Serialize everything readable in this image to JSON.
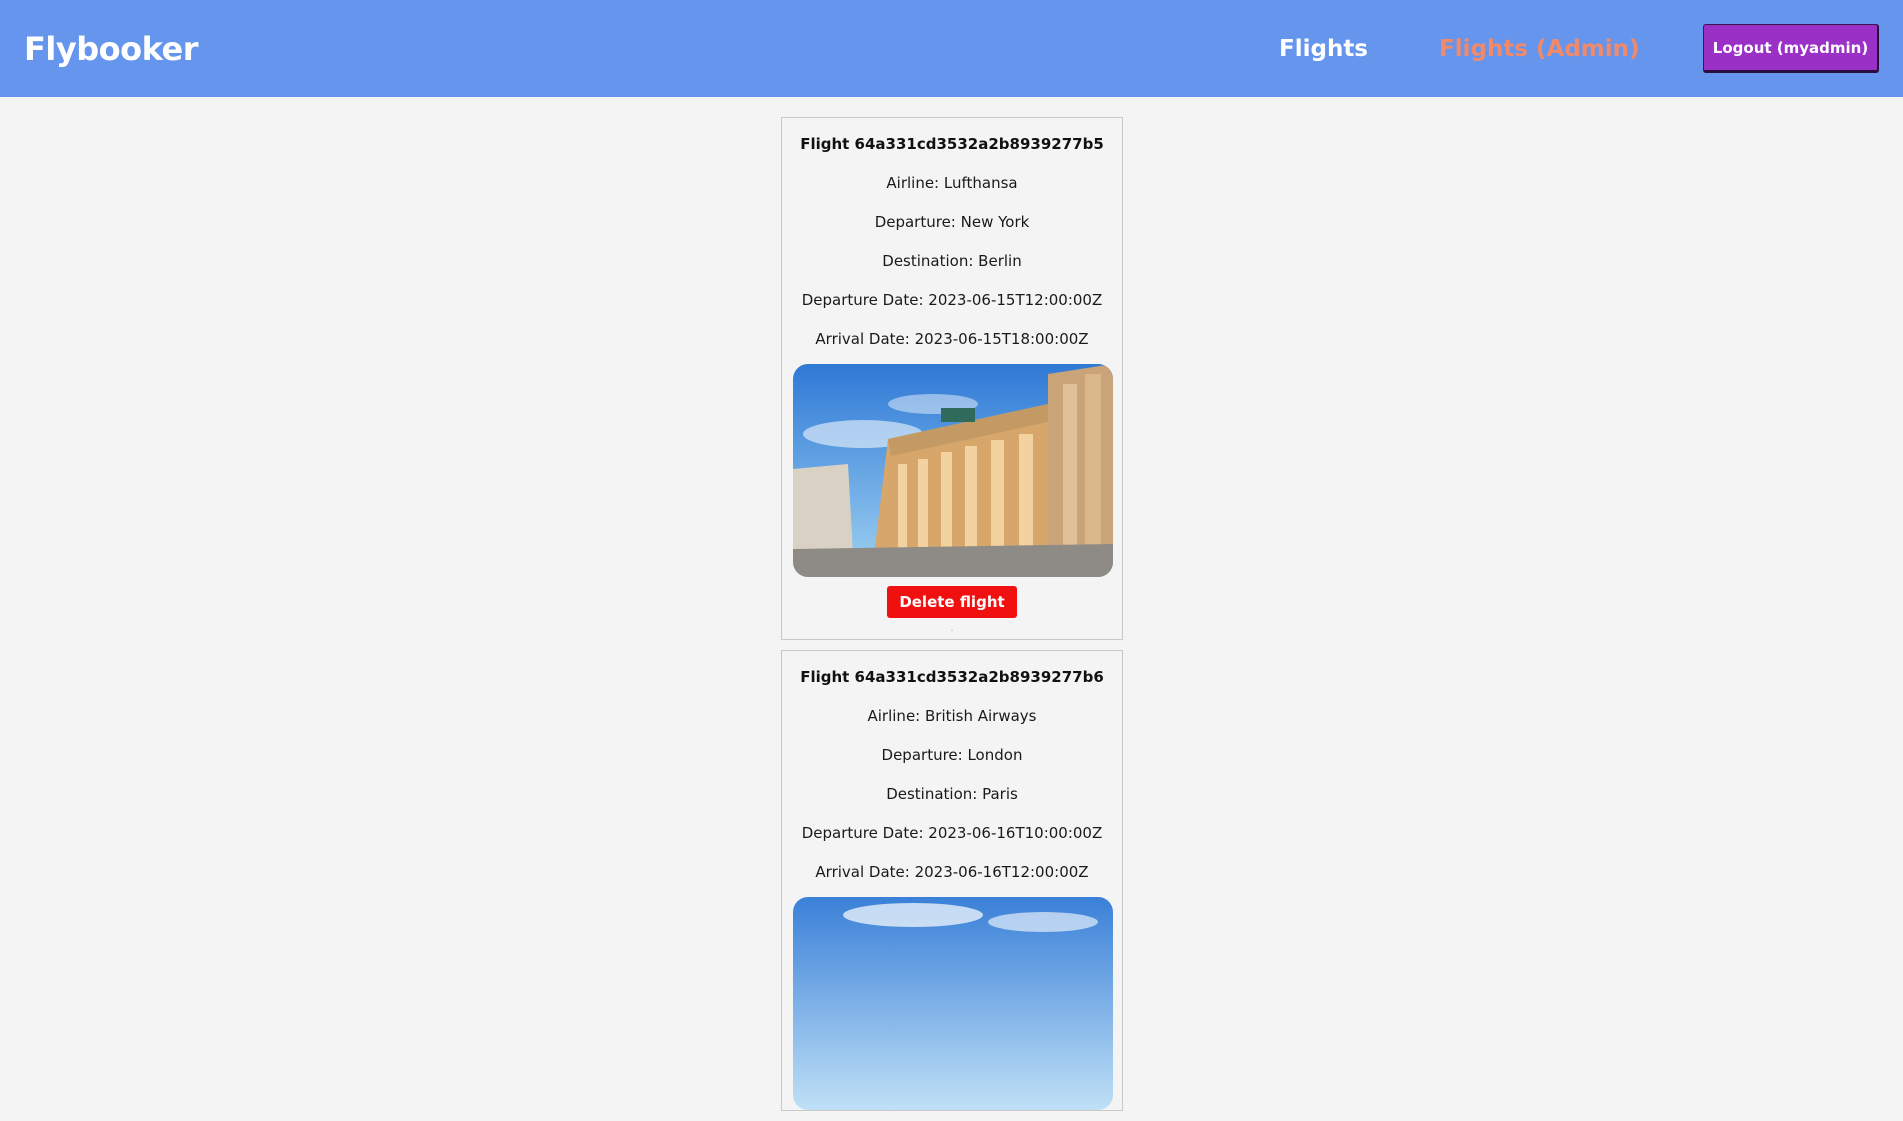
{
  "nav": {
    "brand": "Flybooker",
    "flights_link": "Flights",
    "admin_link": "Flights (Admin)",
    "logout_label": "Logout (myadmin)"
  },
  "flights": [
    {
      "title": "Flight 64a331cd3532a2b8939277b5",
      "airline": "Airline: Lufthansa",
      "departure": "Departure: New York",
      "destination": "Destination: Berlin",
      "departure_date": "Departure Date: 2023-06-15T12:00:00Z",
      "arrival_date": "Arrival Date: 2023-06-15T18:00:00Z",
      "delete_label": "Delete flight",
      "footnote": "."
    },
    {
      "title": "Flight 64a331cd3532a2b8939277b6",
      "airline": "Airline: British Airways",
      "departure": "Departure: London",
      "destination": "Destination: Paris",
      "departure_date": "Departure Date: 2023-06-16T10:00:00Z",
      "arrival_date": "Arrival Date: 2023-06-16T12:00:00Z"
    }
  ],
  "colors": {
    "navbar": "#6595ec",
    "admin_link": "#f08a6a",
    "logout_button": "#9b30c7",
    "delete_button": "#f01010"
  }
}
